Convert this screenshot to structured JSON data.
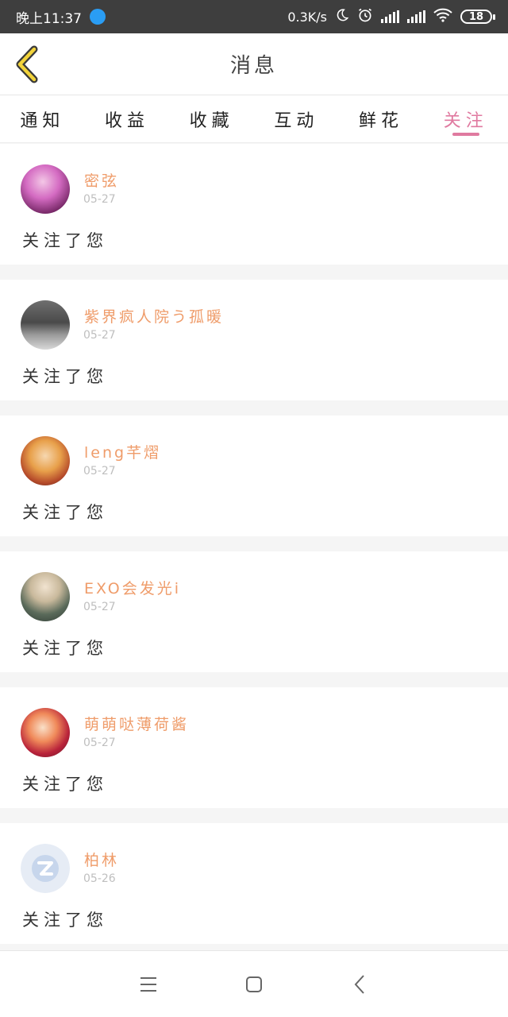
{
  "status_bar": {
    "time": "晚上11:37",
    "network_speed": "0.3K/s",
    "battery": "18",
    "icons": [
      "app-icon",
      "moon-icon",
      "alarm-icon",
      "signal-icon",
      "signal-icon",
      "wifi-icon",
      "battery-icon"
    ]
  },
  "header": {
    "title": "消息",
    "back_icon": "chevron-left-icon",
    "accent": "#f2d33a"
  },
  "tabs": [
    {
      "label": "通知",
      "active": false
    },
    {
      "label": "收益",
      "active": false
    },
    {
      "label": "收藏",
      "active": false
    },
    {
      "label": "互动",
      "active": false
    },
    {
      "label": "鲜花",
      "active": false
    },
    {
      "label": "关注",
      "active": true
    }
  ],
  "colors": {
    "active_tab": "#e07aa0",
    "username": "#ef9c6a",
    "date": "#bfbfbf"
  },
  "notifications": [
    {
      "username": "密弦",
      "date": "05-27",
      "message": "关注了您"
    },
    {
      "username": "紫界疯人院う孤暖",
      "date": "05-27",
      "message": "关注了您"
    },
    {
      "username": "leng芊熠",
      "date": "05-27",
      "message": "关注了您"
    },
    {
      "username": "EXO会发光i",
      "date": "05-27",
      "message": "关注了您"
    },
    {
      "username": "萌萌哒薄荷酱",
      "date": "05-27",
      "message": "关注了您"
    },
    {
      "username": "柏林",
      "date": "05-26",
      "message": "关注了您"
    }
  ],
  "nav_bar": {
    "icons": [
      "menu-icon",
      "home-icon",
      "back-icon"
    ]
  }
}
